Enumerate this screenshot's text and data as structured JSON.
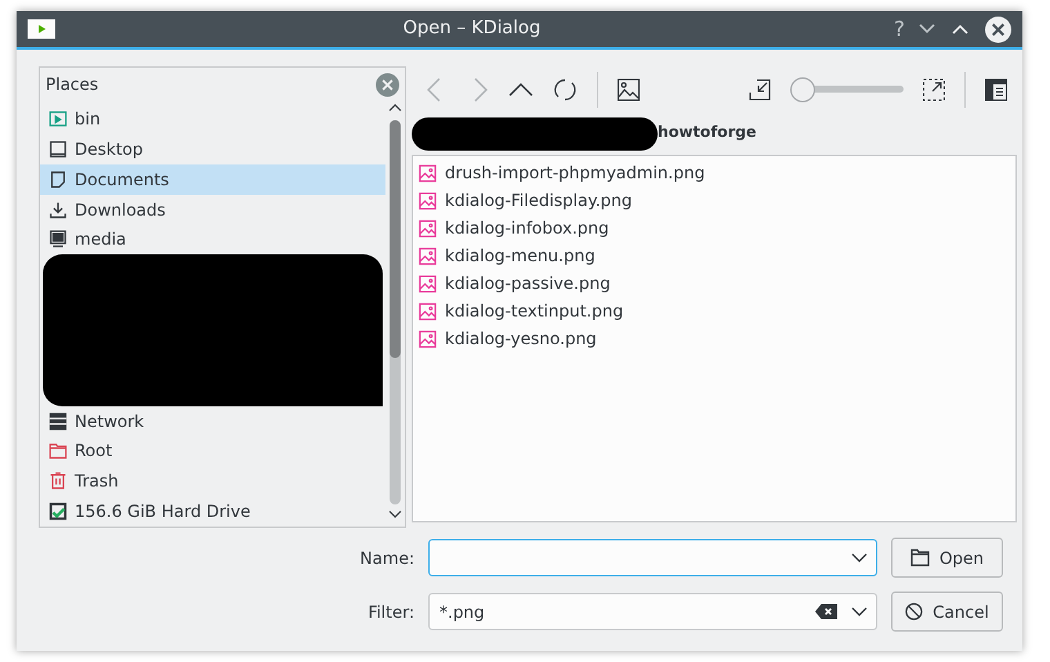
{
  "window": {
    "title": "Open – KDialog",
    "controls": [
      "?"
    ]
  },
  "places": {
    "title": "Places",
    "items": [
      {
        "label": "bin",
        "kind": "exec",
        "selected": false
      },
      {
        "label": "Desktop",
        "kind": "desktop",
        "selected": false
      },
      {
        "label": "Documents",
        "kind": "document",
        "selected": true
      },
      {
        "label": "Downloads",
        "kind": "download",
        "selected": false
      },
      {
        "label": "media",
        "kind": "drive",
        "selected": false
      },
      {
        "kind": "redacted"
      },
      {
        "label": "Network",
        "kind": "network",
        "selected": false
      },
      {
        "label": "Root",
        "kind": "folder",
        "selected": false
      },
      {
        "label": "Trash",
        "kind": "trash",
        "selected": false
      },
      {
        "label": "156.6 GiB Hard Drive",
        "kind": "harddrive",
        "selected": false
      }
    ]
  },
  "toolbar": {
    "zoom": {
      "level": 0
    }
  },
  "breadcrumb": {
    "current": "howtoforge"
  },
  "files": [
    {
      "name": "drush-import-phpmyadmin.png"
    },
    {
      "name": "kdialog-Filedisplay.png"
    },
    {
      "name": "kdialog-infobox.png"
    },
    {
      "name": "kdialog-menu.png"
    },
    {
      "name": "kdialog-passive.png"
    },
    {
      "name": "kdialog-textinput.png"
    },
    {
      "name": "kdialog-yesno.png"
    }
  ],
  "name_field": {
    "label": "Name:"
  },
  "filter_field": {
    "label": "Filter:",
    "value": "*.png"
  },
  "buttons": [
    {
      "label": "Open",
      "kind": "open"
    },
    {
      "label": "Cancel",
      "kind": "cancel"
    }
  ]
}
